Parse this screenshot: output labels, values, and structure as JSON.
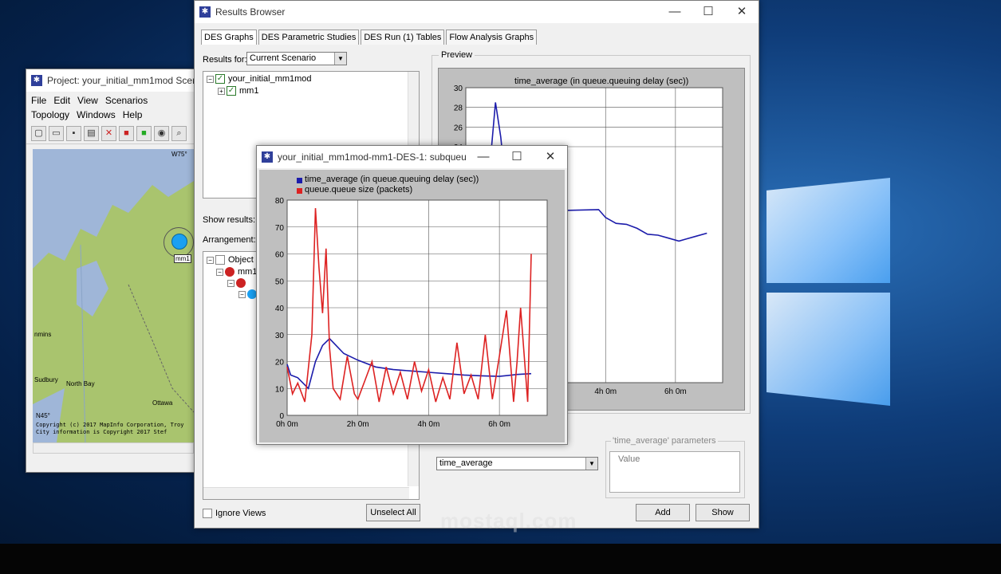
{
  "project": {
    "title": "Project: your_initial_mm1mod Scenario",
    "menu": [
      "File",
      "Edit",
      "View",
      "Scenarios",
      "Topology",
      "Windows",
      "Help"
    ],
    "map": {
      "labels": [
        "W75°",
        "mm1",
        "nmins",
        "Sudbury",
        "North Bay",
        "Ottawa",
        "N45°"
      ],
      "copyright": [
        "Copyright (c) 2017 MapInfo Corporation, Troy",
        "City information is Copyright 2017 Stef"
      ]
    }
  },
  "results_browser": {
    "title": "Results Browser",
    "tabs": [
      "DES Graphs",
      "DES Parametric Studies",
      "DES Run (1) Tables",
      "Flow Analysis Graphs"
    ],
    "results_for_label": "Results for:",
    "results_for_value": "Current Scenario",
    "tree": [
      "your_initial_mm1mod",
      "mm1"
    ],
    "show_results_label": "Show results:",
    "arrangement_label": "Arrangement:",
    "object_tree": [
      "Object S",
      "mm1"
    ],
    "ignore_views_label": "Ignore Views",
    "unselect_all": "Unselect All",
    "preview_label": "Preview",
    "filter_value": "time_average",
    "params_label": "'time_average' parameters",
    "value_header": "Value",
    "add_button": "Add",
    "show_button": "Show"
  },
  "colors": {
    "blue_series": "#1c1cab",
    "red_series": "#dd2222"
  },
  "chart_data": [
    {
      "type": "line",
      "title": "time_average (in queue.queuing delay (sec))",
      "x_tick_labels": [
        "4h 0m",
        "6h 0m"
      ],
      "ylim": [
        0,
        30
      ],
      "y_ticks": [
        30,
        28,
        26,
        24
      ],
      "series": [
        {
          "name": "",
          "x": [
            0.5,
            0.7,
            0.85,
            1.0,
            1.2,
            1.4,
            3.8,
            4.0,
            4.3,
            4.6,
            4.9,
            5.2,
            5.5,
            5.8,
            6.1,
            6.3,
            6.6,
            6.9
          ],
          "values": [
            18.2,
            22.5,
            28.5,
            25.0,
            18.0,
            17.4,
            17.6,
            16.8,
            16.2,
            16.1,
            15.7,
            15.1,
            15.0,
            14.7,
            14.4,
            14.6,
            14.9,
            15.2
          ]
        }
      ]
    },
    {
      "type": "line",
      "legend": [
        "time_average (in queue.queuing delay (sec))",
        "queue.queue size (packets)"
      ],
      "x_tick_labels": [
        "0h 0m",
        "2h 0m",
        "4h 0m",
        "6h 0m"
      ],
      "ylim": [
        0,
        80
      ],
      "y_ticks": [
        0,
        10,
        20,
        30,
        40,
        50,
        60,
        70,
        80
      ],
      "series": [
        {
          "name": "time_average (in queue.queuing delay (sec))",
          "x": [
            0,
            0.1,
            0.3,
            0.6,
            0.8,
            1.0,
            1.2,
            1.6,
            2.0,
            2.5,
            3.0,
            3.5,
            4.0,
            4.5,
            5.0,
            5.5,
            6.0,
            6.5,
            6.9
          ],
          "values": [
            19,
            15,
            14,
            10,
            20,
            26,
            28.5,
            23,
            20.5,
            18,
            17,
            16.5,
            16,
            15.5,
            15,
            14.7,
            14.5,
            15.2,
            15.5
          ]
        },
        {
          "name": "queue.queue size (packets)",
          "x": [
            0,
            0.15,
            0.3,
            0.5,
            0.7,
            0.8,
            0.9,
            1.0,
            1.1,
            1.2,
            1.3,
            1.5,
            1.7,
            1.9,
            2.0,
            2.2,
            2.4,
            2.6,
            2.8,
            3.0,
            3.2,
            3.4,
            3.6,
            3.8,
            4.0,
            4.2,
            4.4,
            4.6,
            4.8,
            5.0,
            5.2,
            5.4,
            5.6,
            5.8,
            6.0,
            6.2,
            6.4,
            6.5,
            6.6,
            6.8,
            6.9
          ],
          "values": [
            18,
            8,
            12,
            5,
            30,
            77,
            55,
            38,
            62,
            25,
            10,
            6,
            22,
            8,
            6,
            13,
            20,
            5,
            18,
            8,
            16,
            6,
            20,
            9,
            17,
            5,
            14,
            6,
            27,
            8,
            15,
            6,
            30,
            6,
            22,
            39,
            5,
            20,
            40,
            5,
            60
          ]
        }
      ]
    }
  ]
}
